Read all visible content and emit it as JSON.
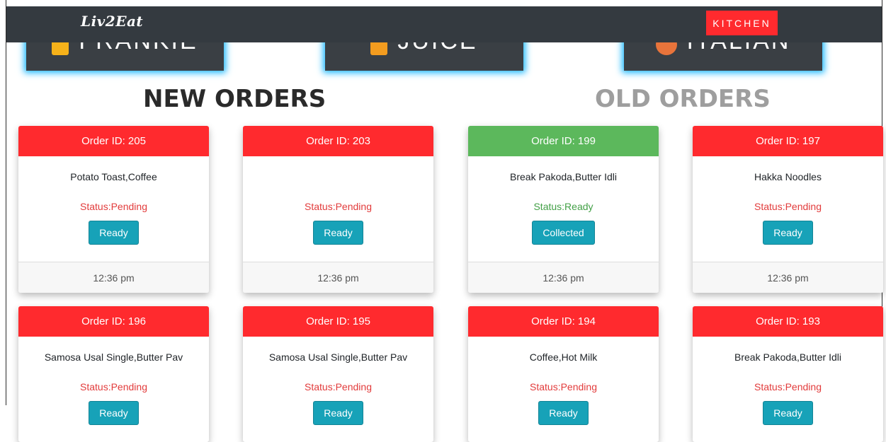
{
  "navbar": {
    "brand": "Liv2Eat",
    "kitchen_label": "KITCHEN"
  },
  "categories": [
    {
      "label": "FRANKIE",
      "icon": "frankie-icon",
      "icon_color": "#f6b21a"
    },
    {
      "label": "JUICE",
      "icon": "juice-icon",
      "icon_color": "#f39c1f"
    },
    {
      "label": "ITALIAN",
      "icon": "pizza-icon",
      "icon_color": "#e8743b"
    }
  ],
  "sections": {
    "new_title": "NEW ORDERS",
    "old_title": "OLD ORDERS"
  },
  "colors": {
    "pending_header": "#ff2a2e",
    "ready_header": "#5cb85c",
    "button": "#17a2b8",
    "nav": "#343a40"
  },
  "orders": [
    {
      "header": "Order ID: 205",
      "items": "Potato Toast,Coffee",
      "status": "Status:Pending",
      "action": "Ready",
      "time": "12:36 pm"
    },
    {
      "header": "Order ID: 203",
      "items": "",
      "status": "Status:Pending",
      "action": "Ready",
      "time": "12:36 pm"
    },
    {
      "header": "Order ID: 199",
      "items": "Break Pakoda,Butter Idli",
      "status": "Status:Ready",
      "action": "Collected",
      "time": "12:36 pm"
    },
    {
      "header": "Order ID: 197",
      "items": "Hakka Noodles",
      "status": "Status:Pending",
      "action": "Ready",
      "time": "12:36 pm"
    },
    {
      "header": "Order ID: 196",
      "items": "Samosa Usal Single,Butter Pav",
      "status": "Status:Pending",
      "action": "Ready",
      "time": ""
    },
    {
      "header": "Order ID: 195",
      "items": "Samosa Usal Single,Butter Pav",
      "status": "Status:Pending",
      "action": "Ready",
      "time": ""
    },
    {
      "header": "Order ID: 194",
      "items": "Coffee,Hot Milk",
      "status": "Status:Pending",
      "action": "Ready",
      "time": ""
    },
    {
      "header": "Order ID: 193",
      "items": "Break Pakoda,Butter Idli",
      "status": "Status:Pending",
      "action": "Ready",
      "time": ""
    }
  ]
}
